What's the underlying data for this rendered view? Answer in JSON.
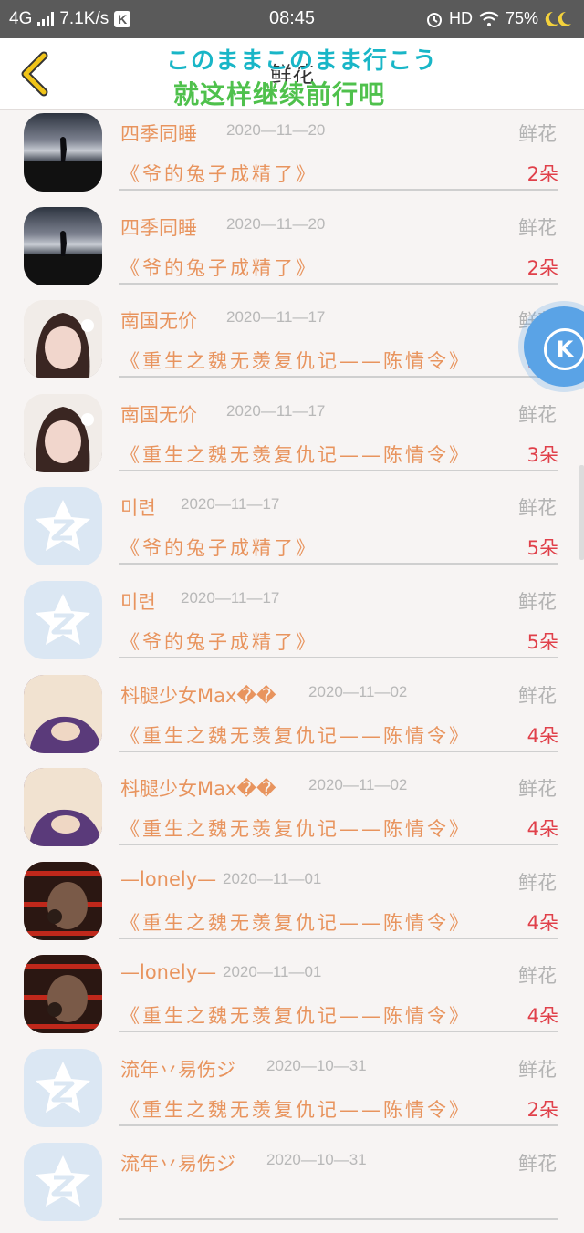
{
  "status_bar": {
    "network": "4G",
    "speed": "7.1K/s",
    "k_icon": "K",
    "time": "08:45",
    "hd": "HD",
    "battery": "75%"
  },
  "header": {
    "title": "鲜花",
    "overlay_line1": "このままこのまま行こう",
    "overlay_line2": "就这样继续前行吧"
  },
  "items": [
    {
      "name": "四季同睡",
      "date": "2020—11—20",
      "type": "鲜花",
      "book": "《爷的兔子成精了》",
      "count": "2朵",
      "avatar": "night"
    },
    {
      "name": "四季同睡",
      "date": "2020—11—20",
      "type": "鲜花",
      "book": "《爷的兔子成精了》",
      "count": "2朵",
      "avatar": "night"
    },
    {
      "name": "南国无价",
      "date": "2020—11—17",
      "type": "鲜花",
      "book": "《重生之魏无羡复仇记——陈情令》",
      "count": "3朵",
      "avatar": "girl"
    },
    {
      "name": "南国无价",
      "date": "2020—11—17",
      "type": "鲜花",
      "book": "《重生之魏无羡复仇记——陈情令》",
      "count": "3朵",
      "avatar": "girl"
    },
    {
      "name": "미련",
      "date": "2020—11—17",
      "type": "鲜花",
      "book": "《爷的兔子成精了》",
      "count": "5朵",
      "avatar": "qq"
    },
    {
      "name": "미련",
      "date": "2020—11—17",
      "type": "鲜花",
      "book": "《爷的兔子成精了》",
      "count": "5朵",
      "avatar": "qq"
    },
    {
      "name": "枓腿少女Max��",
      "date": "2020—11—02",
      "type": "鲜花",
      "book": "《重生之魏无羡复仇记——陈情令》",
      "count": "4朵",
      "avatar": "purple"
    },
    {
      "name": "枓腿少女Max��",
      "date": "2020—11—02",
      "type": "鲜花",
      "book": "《重生之魏无羡复仇记——陈情令》",
      "count": "4朵",
      "avatar": "purple"
    },
    {
      "name": "—lonely—",
      "date": "2020—11—01",
      "type": "鲜花",
      "book": "《重生之魏无羡复仇记——陈情令》",
      "count": "4朵",
      "avatar": "dark"
    },
    {
      "name": "—lonely—",
      "date": "2020—11—01",
      "type": "鲜花",
      "book": "《重生之魏无羡复仇记——陈情令》",
      "count": "4朵",
      "avatar": "dark"
    },
    {
      "name": "流年丷易伤ジ",
      "date": "2020—10—31",
      "type": "鲜花",
      "book": "《重生之魏无羡复仇记——陈情令》",
      "count": "2朵",
      "avatar": "qq"
    },
    {
      "name": "流年丷易伤ジ",
      "date": "2020—10—31",
      "type": "鲜花",
      "book": "",
      "count": "",
      "avatar": "qq"
    }
  ],
  "colors": {
    "accent_orange": "#e8945e",
    "count_red": "#e0404a",
    "back_yellow": "#f0c419"
  }
}
